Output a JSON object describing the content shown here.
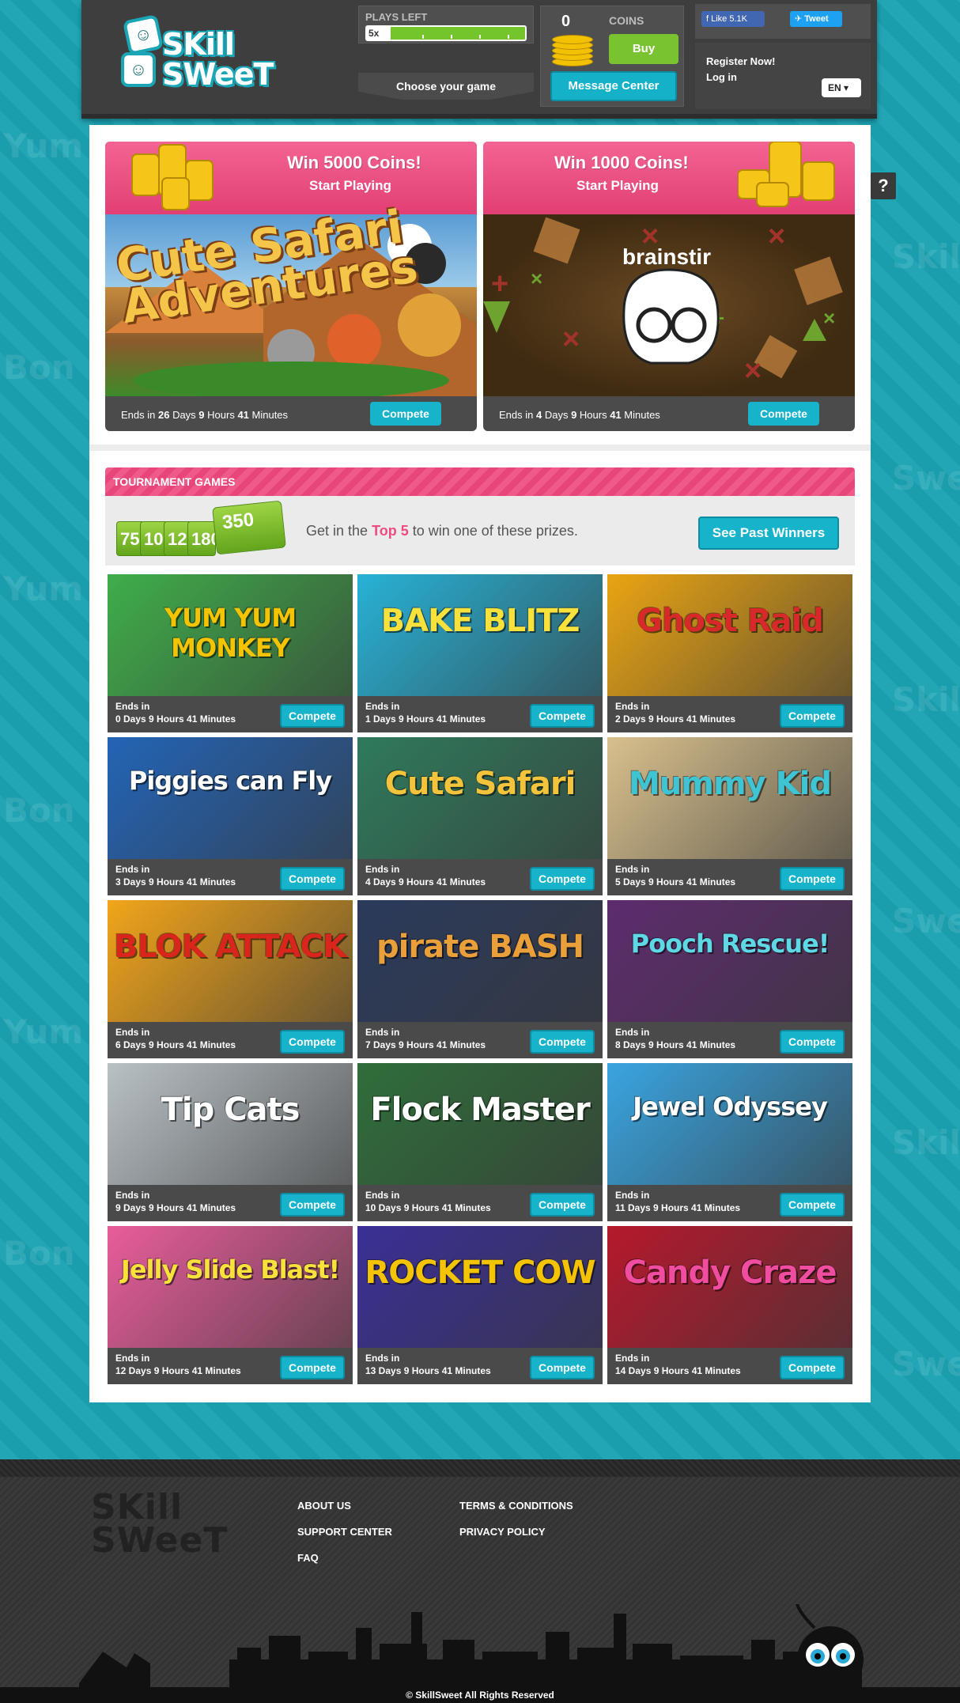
{
  "header": {
    "brand": "Skill Sweet",
    "plays_left_label": "PLAYS LEFT",
    "plays_count": "5x",
    "choose_game": "Choose your game",
    "coins_count": "0",
    "coins_label": "COINS",
    "buy_label": "Buy",
    "message_center": "Message Center",
    "fb_like": "Like 5.1K",
    "tweet": "Tweet",
    "register": "Register Now!",
    "login": "Log in",
    "language": "EN",
    "help": "?"
  },
  "features": [
    {
      "title": "Win 5000 Coins!",
      "subtitle": "Start Playing",
      "game": "Cute Safari Adventures",
      "ends_pre": "Ends in ",
      "ends_days": "26",
      "ends_days_lbl": " Days ",
      "ends_hours": "9",
      "ends_hours_lbl": " Hours ",
      "ends_min": "41",
      "ends_min_lbl": " Minutes",
      "button": "Compete"
    },
    {
      "title": "Win 1000 Coins!",
      "subtitle": "Start Playing",
      "game": "brainstir",
      "ends_pre": "Ends in ",
      "ends_days": "4",
      "ends_days_lbl": " Days ",
      "ends_hours": "9",
      "ends_hours_lbl": " Hours ",
      "ends_min": "41",
      "ends_min_lbl": " Minutes",
      "button": "Compete"
    }
  ],
  "tournament": {
    "header": "TOURNAMENT GAMES",
    "prizes": [
      "75",
      "100",
      "125",
      "180"
    ],
    "top_prize": "350",
    "text_pre": "Get in the ",
    "text_hl": "Top 5",
    "text_post": " to win one of these prizes.",
    "past_winners": "See Past Winners"
  },
  "games": [
    {
      "title": "YUM YUM MONKEY",
      "ends_label": "Ends in",
      "ends": "0 Days 9 Hours 41 Minutes",
      "button": "Compete",
      "bg": "#3fae4a",
      "color": "#f5c400"
    },
    {
      "title": "BAKE BLITZ",
      "ends_label": "Ends in",
      "ends": "1 Days 9 Hours 41 Minutes",
      "button": "Compete",
      "bg": "#27b2d6",
      "color": "#f7e13a"
    },
    {
      "title": "Ghost Raid",
      "ends_label": "Ends in",
      "ends": "2 Days 9 Hours 41 Minutes",
      "button": "Compete",
      "bg": "#e9a413",
      "color": "#d8292a"
    },
    {
      "title": "Piggies can Fly",
      "ends_label": "Ends in",
      "ends": "3 Days 9 Hours 41 Minutes",
      "button": "Compete",
      "bg": "#2364b6",
      "color": "#ffffff"
    },
    {
      "title": "Cute Safari",
      "ends_label": "Ends in",
      "ends": "4 Days 9 Hours 41 Minutes",
      "button": "Compete",
      "bg": "#2f7a5c",
      "color": "#f3c43b"
    },
    {
      "title": "Mummy Kid",
      "ends_label": "Ends in",
      "ends": "5 Days 9 Hours 41 Minutes",
      "button": "Compete",
      "bg": "#d8c08d",
      "color": "#3fc4d4"
    },
    {
      "title": "BLOK ATTACK",
      "ends_label": "Ends in",
      "ends": "6 Days 9 Hours 41 Minutes",
      "button": "Compete",
      "bg": "#f2a51a",
      "color": "#d8261c"
    },
    {
      "title": "pirate BASH",
      "ends_label": "Ends in",
      "ends": "7 Days 9 Hours 41 Minutes",
      "button": "Compete",
      "bg": "#2b3a5c",
      "color": "#e9a03a"
    },
    {
      "title": "Pooch Rescue!",
      "ends_label": "Ends in",
      "ends": "8 Days 9 Hours 41 Minutes",
      "button": "Compete",
      "bg": "#5d2c6e",
      "color": "#5fd8e6"
    },
    {
      "title": "Tip Cats",
      "ends_label": "Ends in",
      "ends": "9 Days 9 Hours 41 Minutes",
      "button": "Compete",
      "bg": "#b9c1c6",
      "color": "#ffffff"
    },
    {
      "title": "Flock Master",
      "ends_label": "Ends in",
      "ends": "10 Days 9 Hours 41 Minutes",
      "button": "Compete",
      "bg": "#2f6e3a",
      "color": "#ffffff"
    },
    {
      "title": "Jewel Odyssey",
      "ends_label": "Ends in",
      "ends": "11 Days 9 Hours 41 Minutes",
      "button": "Compete",
      "bg": "#39a4e0",
      "color": "#ffffff"
    },
    {
      "title": "Jelly Slide Blast!",
      "ends_label": "Ends in",
      "ends": "12 Days 9 Hours 41 Minutes",
      "button": "Compete",
      "bg": "#e85d9a",
      "color": "#f7e13a"
    },
    {
      "title": "ROCKET COW",
      "ends_label": "Ends in",
      "ends": "13 Days 9 Hours 41 Minutes",
      "button": "Compete",
      "bg": "#3a2f96",
      "color": "#f5c400"
    },
    {
      "title": "Candy Craze",
      "ends_label": "Ends in",
      "ends": "14 Days 9 Hours 41 Minutes",
      "button": "Compete",
      "bg": "#b5192c",
      "color": "#f04da0"
    }
  ],
  "footer": {
    "brand_line1": "SKill",
    "brand_line2": "SWeeT",
    "links_col1": [
      "ABOUT US",
      "SUPPORT CENTER",
      "FAQ"
    ],
    "links_col2": [
      "TERMS & CONDITIONS",
      "PRIVACY POLICY"
    ],
    "copyright": "© SkillSweet All Rights Reserved"
  },
  "colors": {
    "teal": "#1aa6b6",
    "pink": "#ee4b80",
    "button_blue": "#16b3cb",
    "buy_green": "#79c230"
  }
}
